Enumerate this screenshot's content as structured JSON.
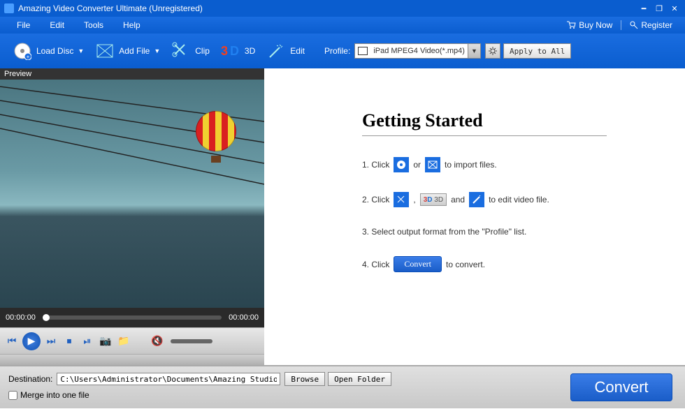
{
  "window": {
    "title": "Amazing Video Converter Ultimate (Unregistered)"
  },
  "menu": {
    "file": "File",
    "edit": "Edit",
    "tools": "Tools",
    "help": "Help",
    "buy_now": "Buy Now",
    "register": "Register"
  },
  "toolbar": {
    "load_disc": "Load Disc",
    "add_file": "Add File",
    "clip": "Clip",
    "3d": "3D",
    "edit": "Edit",
    "profile_label": "Profile:",
    "profile_value": "iPad MPEG4 Video(*.mp4)",
    "apply_all": "Apply to All"
  },
  "preview": {
    "label": "Preview",
    "time_current": "00:00:00",
    "time_total": "00:00:00"
  },
  "getting_started": {
    "title": "Getting Started",
    "step1_a": "1. Click",
    "step1_b": "or",
    "step1_c": "to import files.",
    "step2_a": "2. Click",
    "step2_b": ",",
    "step2_c": "and",
    "step2_d": "to edit video file.",
    "step2_3d": "3D",
    "step3": "3. Select output format from the \"Profile\" list.",
    "step4_a": "4. Click",
    "step4_btn": "Convert",
    "step4_b": "to convert."
  },
  "bottom": {
    "dest_label": "Destination:",
    "dest_value": "C:\\Users\\Administrator\\Documents\\Amazing Studio\\",
    "browse": "Browse",
    "open_folder": "Open Folder",
    "merge": "Merge into one file",
    "convert": "Convert"
  }
}
